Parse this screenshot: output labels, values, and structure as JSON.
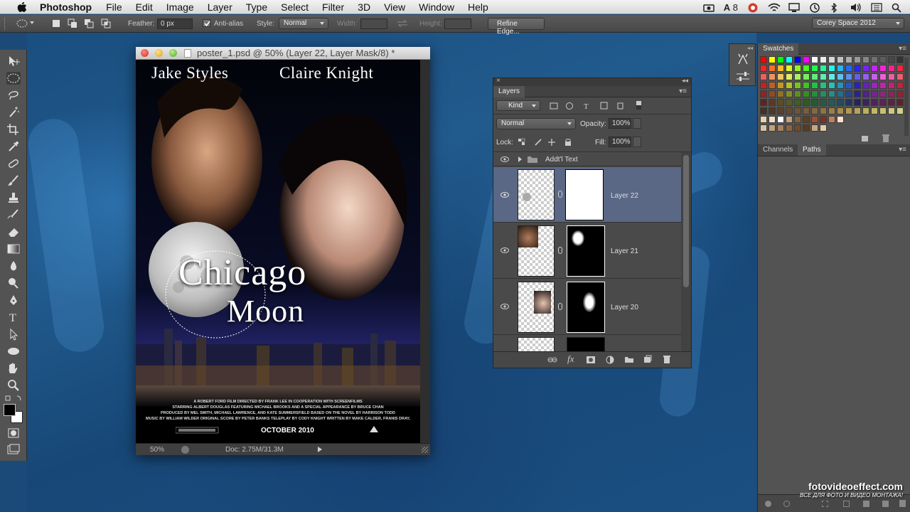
{
  "menubar": {
    "app": "Photoshop",
    "items": [
      "File",
      "Edit",
      "Image",
      "Layer",
      "Type",
      "Select",
      "Filter",
      "3D",
      "View",
      "Window",
      "Help"
    ],
    "tray_text": "8"
  },
  "options": {
    "feather_label": "Feather:",
    "feather_value": "0 px",
    "antialias_label": "Anti-alias",
    "style_label": "Style:",
    "style_value": "Normal",
    "width_label": "Width:",
    "height_label": "Height:",
    "refine_button": "Refine Edge...",
    "workspace": "Corey Space 2012"
  },
  "document": {
    "title": "poster_1.psd @ 50% (Layer 22, Layer Mask/8) *",
    "zoom": "50%",
    "doc_info": "Doc: 2.75M/31.3M",
    "poster": {
      "actor_left": "Jake Styles",
      "actor_right": "Claire Knight",
      "title_1": "Chicago",
      "title_2": "Moon",
      "credits": [
        "A ROBERT FORD FILM   DIRECTED BY FRANK LEE   IN COOPERATION WITH SCREENFILMS",
        "STARRING ALBERT DOUGLAS  FEATURING MICHAEL BROOKS  AND A SPECIAL APPEARANCE BY BRUCE CHAN",
        "PRODUCED BY MEL SMITH, MICHAEL LAWRENCE, AND KATE SUMMERSFIELD  BASED ON THE NOVEL BY HARRISON TODD",
        "MUSIC BY WILLIAM WILDER  ORIGINAL SCORE BY PETER BANKS  TELEPLAY BY CODY KNIGHT  WRITTEN BY MAKE CALDER, FRANIS DRAY,"
      ],
      "date": "OCTOBER 2010"
    }
  },
  "layers": {
    "tab": "Layers",
    "kind": "Kind",
    "blend": "Normal",
    "opacity_label": "Opacity:",
    "opacity": "100%",
    "lock_label": "Lock:",
    "fill_label": "Fill:",
    "fill": "100%",
    "group": "Addt'l Text",
    "rows": [
      {
        "name": "Layer 22"
      },
      {
        "name": "Layer 21"
      },
      {
        "name": "Layer 20"
      }
    ],
    "fx": "fx"
  },
  "swatches": {
    "tab": "Swatches"
  },
  "paths": {
    "tabs": [
      "Channels",
      "Paths"
    ]
  },
  "watermark": {
    "site": "fotovideoeffect.com",
    "tagline": "ВСЕ ДЛЯ ФОТО И ВИДЕО МОНТАЖА!"
  }
}
